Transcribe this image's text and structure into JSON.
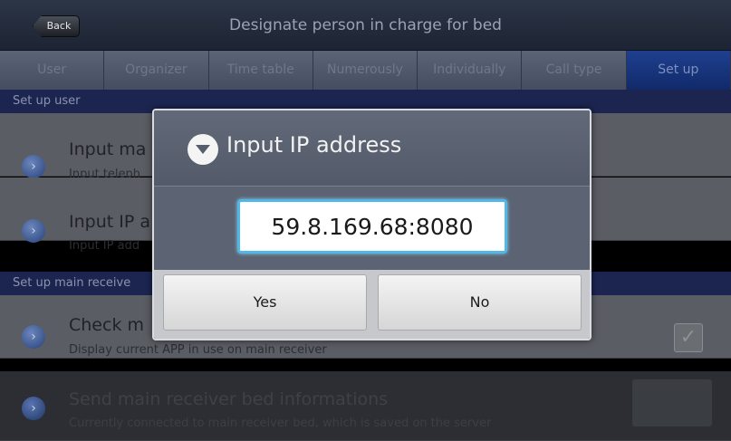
{
  "header": {
    "back_label": "Back",
    "title": "Designate person in charge for bed"
  },
  "tabs": [
    {
      "label": "User"
    },
    {
      "label": "Organizer"
    },
    {
      "label": "Time table"
    },
    {
      "label": "Numerously"
    },
    {
      "label": "Individually"
    },
    {
      "label": "Call type"
    },
    {
      "label": "Set up",
      "active": true
    }
  ],
  "sections": {
    "user_header": "Set up user",
    "main_receiver_header": "Set up main receive"
  },
  "items": [
    {
      "title": "Input ma",
      "subtitle": "Input teleph"
    },
    {
      "title": "Input IP a",
      "subtitle": "Input IP add"
    },
    {
      "title": "Check m",
      "subtitle": "Display current APP in use on main receiver",
      "checked": true
    },
    {
      "title": "Send main receiver bed informations",
      "subtitle": "Currently connected to main receiver bed, which is saved on the server"
    }
  ],
  "dialog": {
    "title": "Input IP address",
    "ip_value": "59.8.169.68:8080",
    "yes_label": "Yes",
    "no_label": "No"
  },
  "icons": {
    "item_icon": "chevron-right-circle-icon",
    "dialog_icon": "dropdown-arrow-icon",
    "checkbox_icon": "checkmark-icon"
  },
  "colors": {
    "accent_input_border": "#52b6e6",
    "active_tab": "#1f3f8f",
    "title_bar": "#2c3546"
  }
}
